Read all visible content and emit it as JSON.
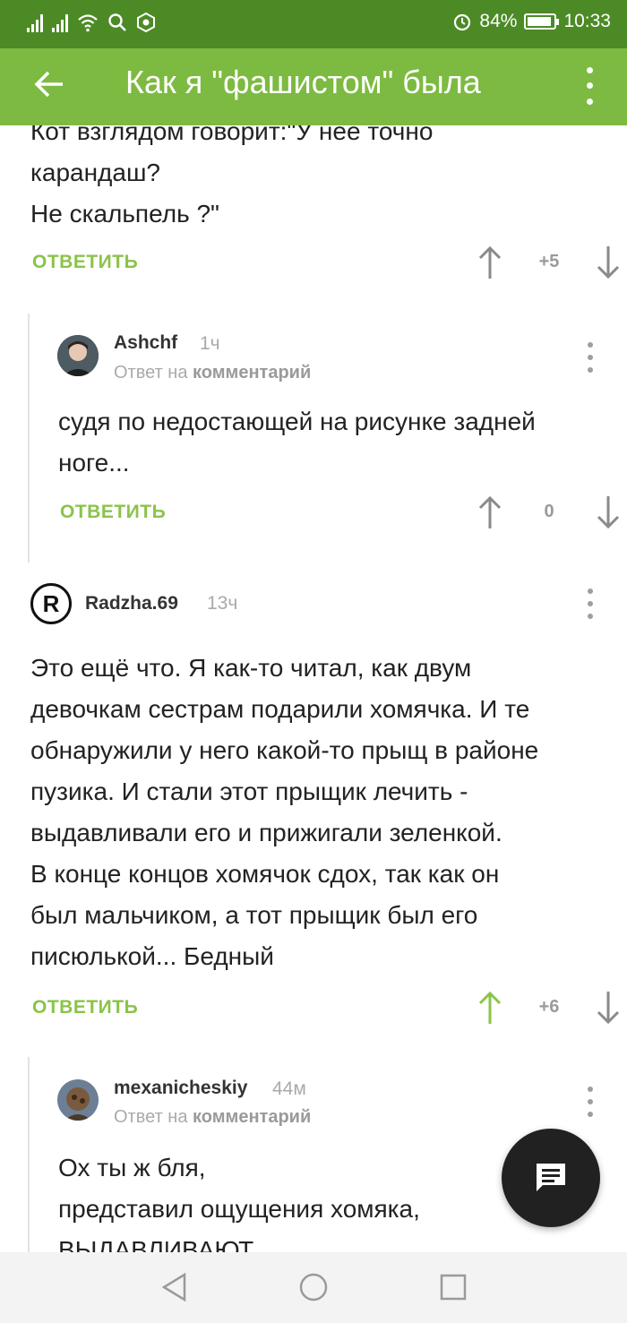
{
  "status_bar": {
    "icons": [
      "signal-icon",
      "signal-icon",
      "wifi-icon",
      "search-icon",
      "app-icon",
      "alarm-icon",
      "battery-icon"
    ],
    "battery": "84%",
    "time": "10:33"
  },
  "app_bar": {
    "back_icon": "arrow-left-icon",
    "title": "Как я \"фашистом\" была",
    "more_icon": "more-vertical-icon"
  },
  "comments": [
    {
      "lines": [
        "Кот взглядом говорит:\"У нее точно",
        "карандаш?",
        "Не скальпель ?\""
      ],
      "reply_label": "ОТВЕТИТЬ",
      "score": "+5",
      "upvoted": false
    },
    {
      "author": "Ashchf",
      "time": "1ч",
      "reply_to_prefix": "Ответ на",
      "reply_to_link": "комментарий",
      "lines": [
        "судя по недостающей на рисунке задней",
        "ноге..."
      ],
      "reply_label": "ОТВЕТИТЬ",
      "score": "0",
      "upvoted": false
    },
    {
      "author": "Radzha.69",
      "avatar_letter": "R",
      "time": "13ч",
      "lines": [
        "Это ещё что. Я как-то читал, как двум",
        "девочкам сестрам подарили хомячка. И те",
        "обнаружили у него какой-то прыщ в районе",
        "пузика. И стали этот прыщик лечить -",
        "выдавливали его и прижигали зеленкой.",
        "В конце концов хомячок сдох, так как он",
        "был мальчиком, а тот прыщик был его",
        "писюлькой... Бедный"
      ],
      "reply_label": "ОТВЕТИТЬ",
      "score": "+6",
      "upvoted": true
    },
    {
      "author": "mexanicheskiy",
      "time": "44м",
      "reply_to_prefix": "Ответ на",
      "reply_to_link": "комментарий",
      "lines": [
        "Ох ты ж бля,",
        "представил ощущения хомяка,",
        "выдавливают"
      ]
    }
  ],
  "fab_icon": "comment-icon",
  "nav_bar": {
    "icons": [
      "back-triangle-icon",
      "home-circle-icon",
      "recents-square-icon"
    ]
  },
  "colors": {
    "status_bar": "#4c8a26",
    "app_bar": "#7dba41",
    "accent": "#8bc34a",
    "fab": "#212121"
  }
}
